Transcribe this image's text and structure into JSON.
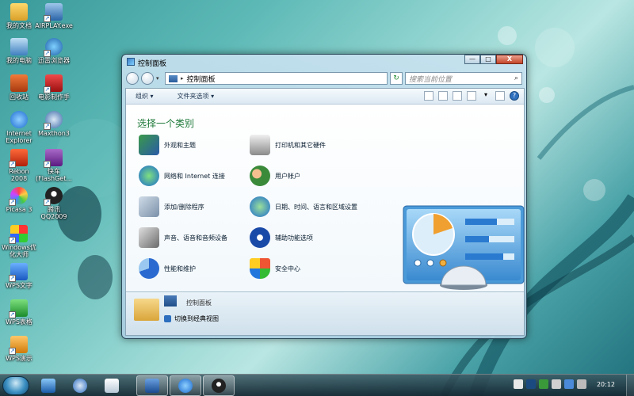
{
  "desktop": {
    "icons": [
      {
        "label": "我的文档",
        "name": "my-documents"
      },
      {
        "label": "AIRPLAY.exe",
        "name": "airplay-shortcut"
      },
      {
        "label": "我的电脑",
        "name": "my-computer"
      },
      {
        "label": "迅雷浏览器",
        "name": "browser-shortcut"
      },
      {
        "label": "回收站",
        "name": "recycle-bin"
      },
      {
        "label": "电影制作手",
        "name": "movie-maker-shortcut"
      },
      {
        "label": "Internet Explorer",
        "name": "internet-explorer"
      },
      {
        "label": "Maxthon3",
        "name": "maxthon-shortcut"
      },
      {
        "label": "Rebon 2008",
        "name": "rebon-shortcut"
      },
      {
        "label": "快车(FlashGet...",
        "name": "flashget-shortcut"
      },
      {
        "label": "Picasa 3",
        "name": "picasa-shortcut"
      },
      {
        "label": "腾讯QQ2009",
        "name": "qq-shortcut"
      },
      {
        "label": "Windows优化大师",
        "name": "optimizer-shortcut"
      },
      {
        "label": "WPS文字",
        "name": "wps-writer-shortcut"
      },
      {
        "label": "WPS表格",
        "name": "wps-spreadsheet-shortcut"
      },
      {
        "label": "WPS演示",
        "name": "wps-presentation-shortcut"
      }
    ]
  },
  "window": {
    "title": "控制面板",
    "caption": {
      "minimize": "—",
      "maximize": "□",
      "close": "X"
    },
    "address": {
      "path": "控制面板",
      "separator": "▸"
    },
    "search": {
      "placeholder": "搜索当前位置",
      "icon": "⌕"
    },
    "toolbar": {
      "organize": "组织 ▾",
      "folder_options": "文件夹选项 ▾"
    },
    "heading": "选择一个类别",
    "categories_left": [
      "外观和主题",
      "网络和 Internet 连接",
      "添加/删除程序",
      "声音、语音和音频设备",
      "性能和维护"
    ],
    "categories_right": [
      "打印机和其它硬件",
      "用户帐户",
      "日期、时间、语言和区域设置",
      "辅助功能选项",
      "安全中心"
    ],
    "details": {
      "name": "控制面板",
      "switch_label": "切换到经典视图"
    }
  },
  "taskbar": {
    "clock": "20:12"
  },
  "colors": {
    "heading": "#1f7a3a",
    "accent": "#2d6fbe"
  }
}
